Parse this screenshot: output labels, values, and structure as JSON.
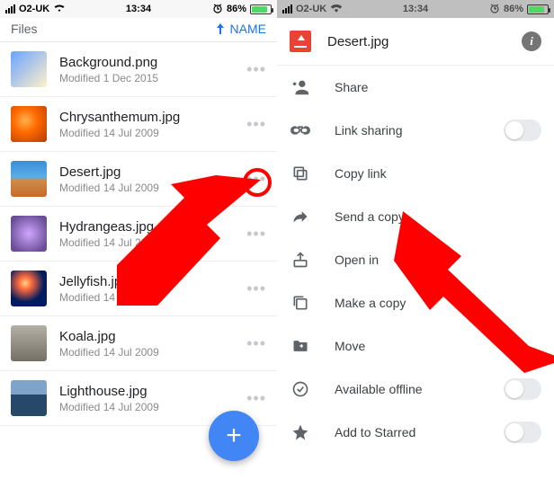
{
  "status": {
    "carrier": "O2-UK",
    "time": "13:34",
    "battery_pct": "86%"
  },
  "left": {
    "header_left": "Files",
    "header_right": "NAME",
    "files": [
      {
        "name": "Background.png",
        "modified": "Modified 1 Dec 2015"
      },
      {
        "name": "Chrysanthemum.jpg",
        "modified": "Modified 14 Jul 2009"
      },
      {
        "name": "Desert.jpg",
        "modified": "Modified 14 Jul 2009"
      },
      {
        "name": "Hydrangeas.jpg",
        "modified": "Modified 14 Jul 2009"
      },
      {
        "name": "Jellyfish.jpg",
        "modified": "Modified 14 Jul 2009"
      },
      {
        "name": "Koala.jpg",
        "modified": "Modified 14 Jul 2009"
      },
      {
        "name": "Lighthouse.jpg",
        "modified": "Modified 14 Jul 2009"
      }
    ]
  },
  "right": {
    "title": "Desert.jpg",
    "actions": {
      "share": "Share",
      "link_sharing": "Link sharing",
      "copy_link": "Copy link",
      "send_copy": "Send a copy",
      "open_in": "Open in",
      "make_copy": "Make a copy",
      "move": "Move",
      "available_offline": "Available offline",
      "add_starred": "Add to Starred"
    }
  },
  "colors": {
    "accent": "#4285f4",
    "highlight": "#ff0000",
    "battery_fill": "#4cd964"
  }
}
